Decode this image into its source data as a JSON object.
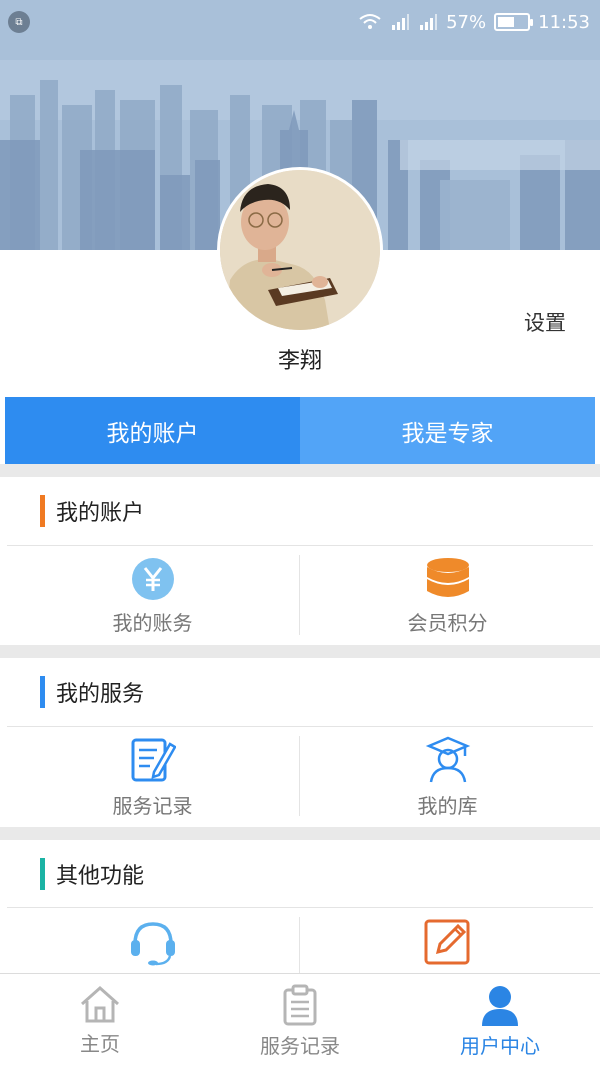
{
  "status_bar": {
    "battery_percent": "57%",
    "time": "11:53",
    "battery_level": 0.57
  },
  "profile": {
    "name": "李翔",
    "settings_label": "设置"
  },
  "account_tabs": [
    {
      "label": "我的账户",
      "active": true
    },
    {
      "label": "我是专家",
      "active": false
    }
  ],
  "sections": {
    "account": {
      "title": "我的账户",
      "accent": "#f07a22",
      "items": [
        {
          "label": "我的账务",
          "icon": "yuan-coin-icon"
        },
        {
          "label": "会员积分",
          "icon": "database-coins-icon"
        }
      ]
    },
    "service": {
      "title": "我的服务",
      "accent": "#2e8cf0",
      "items": [
        {
          "label": "服务记录",
          "icon": "document-edit-icon"
        },
        {
          "label": "我的库",
          "icon": "graduate-user-icon"
        }
      ]
    },
    "other": {
      "title": "其他功能",
      "accent": "#1bb3a4",
      "items": [
        {
          "label": "",
          "icon": "headset-icon"
        },
        {
          "label": "",
          "icon": "edit-square-icon"
        }
      ]
    }
  },
  "bottom_nav": [
    {
      "label": "主页",
      "icon": "home-icon",
      "active": false
    },
    {
      "label": "服务记录",
      "icon": "clipboard-icon",
      "active": false
    },
    {
      "label": "用户中心",
      "icon": "user-icon",
      "active": true
    }
  ],
  "colors": {
    "primary": "#2e8cf0",
    "tab_inactive": "#52a4f7",
    "orange": "#ef8a2a"
  }
}
